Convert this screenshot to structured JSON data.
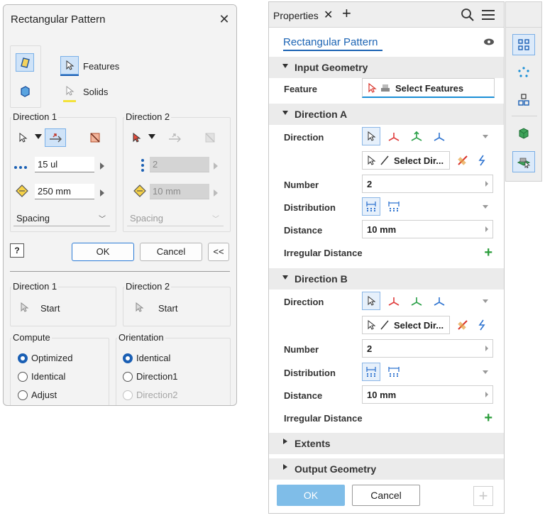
{
  "dialog": {
    "title": "Rectangular Pattern",
    "close_icon": "close-icon",
    "features_label": "Features",
    "solids_label": "Solids",
    "direction1": {
      "group_label": "Direction 1",
      "count": "15 ul",
      "distance": "250 mm",
      "spacing": "Spacing"
    },
    "direction2": {
      "group_label": "Direction 2",
      "count": "2",
      "distance": "10 mm",
      "spacing": "Spacing"
    },
    "ok_label": "OK",
    "cancel_label": "Cancel",
    "more_label": "<<",
    "start1_group": "Direction 1",
    "start2_group": "Direction 2",
    "start_label": "Start",
    "compute": {
      "label": "Compute",
      "options": [
        "Optimized",
        "Identical",
        "Adjust"
      ],
      "selected": "Optimized"
    },
    "orientation": {
      "label": "Orientation",
      "options": [
        "Identical",
        "Direction1",
        "Direction2"
      ],
      "selected": "Identical"
    }
  },
  "panel": {
    "tab_label": "Properties",
    "feature_name": "Rectangular Pattern",
    "sections": {
      "input_geometry": "Input Geometry",
      "direction_a": "Direction A",
      "direction_b": "Direction B",
      "extents": "Extents",
      "output_geometry": "Output Geometry"
    },
    "feature_label": "Feature",
    "select_features": "Select Features",
    "direction_label": "Direction",
    "select_dir": "Select Dir...",
    "number_label": "Number",
    "distribution_label": "Distribution",
    "distance_label": "Distance",
    "irregular_label": "Irregular Distance",
    "dir_a": {
      "number": "2",
      "distance": "10 mm"
    },
    "dir_b": {
      "number": "2",
      "distance": "10 mm"
    },
    "ok_label": "OK",
    "cancel_label": "Cancel"
  },
  "colors": {
    "accent": "#1a5fb4",
    "link": "#1c64b4",
    "ok_button": "#7fbde8",
    "add_green": "#2a9d3a"
  }
}
